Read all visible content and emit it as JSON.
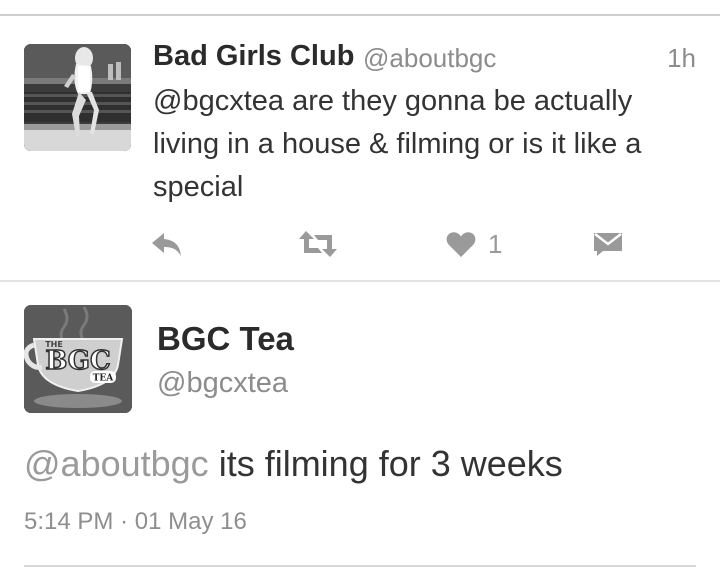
{
  "reply_tweet": {
    "author_name": "Bad Girls Club",
    "author_handle": "@aboutbgc",
    "age": "1h",
    "text": "@bgcxtea are they gonna be actually living in a house & filming or is it like a special",
    "avatar_icon": "profile-photo",
    "actions": {
      "reply_icon": "reply-icon",
      "retweet_icon": "retweet-icon",
      "like_icon": "heart-icon",
      "like_count": "1",
      "dm_icon": "direct-message-icon"
    }
  },
  "main_tweet": {
    "author_name": "BGC Tea",
    "author_handle": "@bgcxtea",
    "mention": "@aboutbgc",
    "text": " its filming for 3 weeks",
    "timestamp": "5:14 PM",
    "separator": "·",
    "date": "01 May 16",
    "avatar_logo_text": "BGC",
    "avatar_logo_sub": "TEA",
    "avatar_logo_top": "THE"
  },
  "colors": {
    "divider": "#e2e2e2",
    "secondary_text": "#8c8c8c",
    "primary_text": "#333333",
    "icon_gray": "#9a9a9a"
  }
}
